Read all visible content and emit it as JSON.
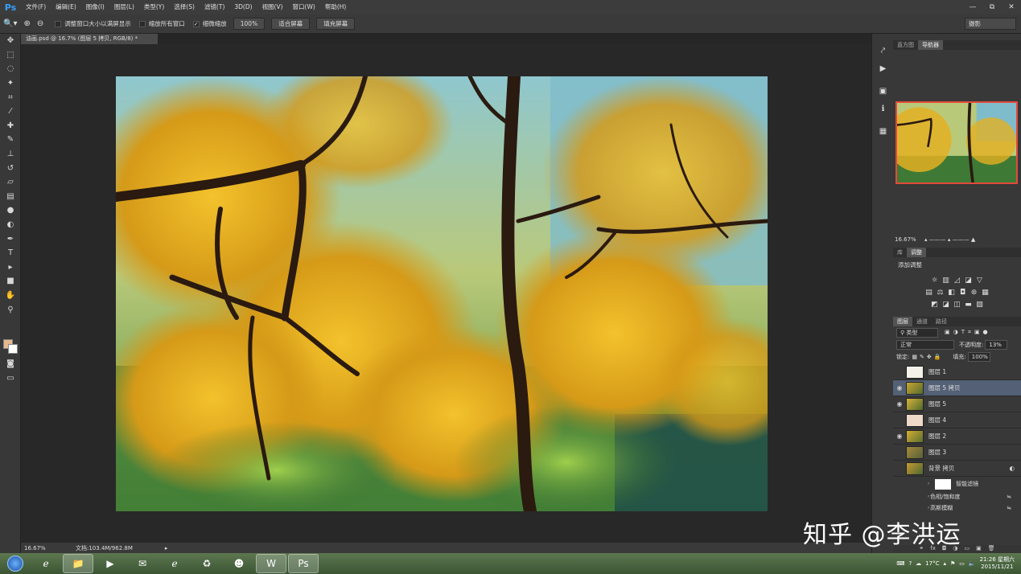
{
  "app": {
    "logo": "Ps",
    "menu": [
      "文件(F)",
      "编辑(E)",
      "图像(I)",
      "图层(L)",
      "类型(Y)",
      "选择(S)",
      "滤镜(T)",
      "3D(D)",
      "视图(V)",
      "窗口(W)",
      "帮助(H)"
    ]
  },
  "window_controls": [
    "—",
    "⧉",
    "✕"
  ],
  "options": {
    "zoom_in_icon": "⊕",
    "zoom_out_icon": "⊖",
    "resize_windows": "调整窗口大小以满屏显示",
    "zoom_all": "缩放所有窗口",
    "scrubby_zoom": "细微缩放",
    "zoom_pct": "100%",
    "fit_screen": "适合屏幕",
    "fill_screen": "填充屏幕",
    "workspace": "摄影"
  },
  "doc_tab": "油画.psd @ 16.7% (图层 5 拷贝, RGB/8) *",
  "status": {
    "zoom": "16.67%",
    "doc_info": "文档:103.4M/962.8M"
  },
  "navigator": {
    "tabs": [
      "直方图",
      "导航器"
    ],
    "active": 1,
    "zoom": "16.67%"
  },
  "adjustments": {
    "tabs": [
      "库",
      "调整"
    ],
    "active": 1,
    "title": "添加调整"
  },
  "layers_panel": {
    "tabs": [
      "图层",
      "通道",
      "路径"
    ],
    "active": 0,
    "filter": "类型",
    "blend": "正常",
    "opacity_label": "不透明度:",
    "opacity": "13%",
    "lock_label": "锁定:",
    "fill_label": "填充:",
    "fill": "100%",
    "layers": [
      {
        "name": "图层 1",
        "visible": false,
        "active": false
      },
      {
        "name": "图层 5 拷贝",
        "visible": true,
        "active": true
      },
      {
        "name": "图层 5",
        "visible": true,
        "active": false
      },
      {
        "name": "图层 4",
        "visible": false,
        "active": false
      },
      {
        "name": "图层 2",
        "visible": true,
        "active": false
      },
      {
        "name": "图层 3",
        "visible": false,
        "active": false
      },
      {
        "name": "背景 拷贝",
        "visible": false,
        "active": false
      }
    ],
    "smart_filters": "智能滤镜",
    "filters": [
      "色相/饱和度",
      "高斯模糊"
    ]
  },
  "taskbar": {
    "clock_time": "21:26 星期六",
    "clock_date": "2015/11/21",
    "weather": "17°C"
  },
  "watermark": "知乎 @李洪运"
}
